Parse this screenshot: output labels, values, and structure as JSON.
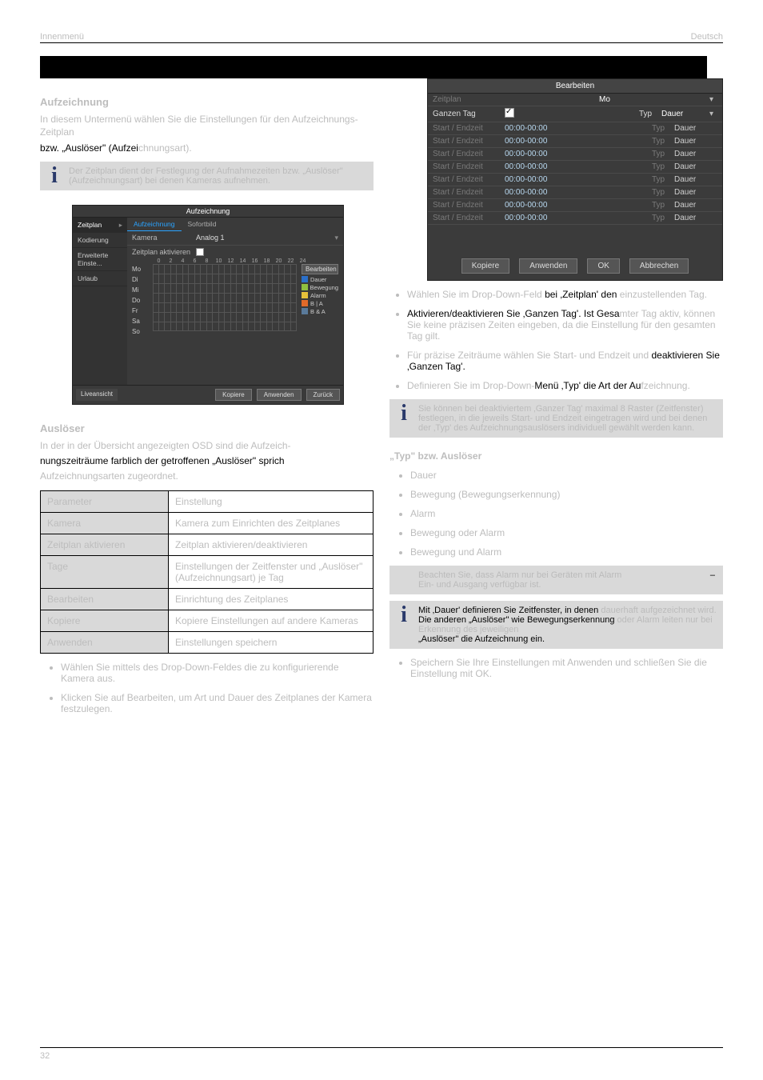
{
  "header": {
    "left": "Innenmenü",
    "right": "Deutsch"
  },
  "leftcol": {
    "h_aufzeichnung": "Aufzeichnung",
    "p_intro_faint": "In diesem Untermenü wählen Sie die Einstellungen für den Aufzeichnungs-Zeitplan",
    "p_trigger_before": "bzw. „Auslöser\" (Aufzei",
    "p_trigger_after": "chnungsart).",
    "info1": "Der Zeitplan dient der Festlegung der Aufnahmezeiten bzw. „Auslöser\" (Aufzeichnungsart) bei denen Kameras aufnehmen.",
    "h_ausloser": "Auslöser",
    "p_belowchart": "In der in der Übersicht angezeigten OSD sind die Aufzeich-",
    "p_color_line": "nungszeiträume farblich der getroffenen „Auslöser\" sprich",
    "p_color_after": "Aufzeichnungsarten zugeordnet.",
    "table": {
      "rows": [
        {
          "k": "Parameter",
          "v": "Einstellung"
        },
        {
          "k": "Kamera",
          "v": "Kamera zum Einrichten des Zeitplanes"
        },
        {
          "k": "Zeitplan aktivieren",
          "v": "Zeitplan aktivieren/deaktivieren"
        },
        {
          "k": "Tage",
          "v": "Einstellungen der Zeitfenster und „Auslöser\" (Aufzeichnungsart) je Tag"
        },
        {
          "k": "Bearbeiten",
          "v": "Einrichtung des Zeitplanes"
        },
        {
          "k": "Kopiere",
          "v": "Kopiere Einstellungen auf andere Kameras"
        },
        {
          "k": "Anwenden",
          "v": "Einstellungen speichern"
        }
      ]
    },
    "bullets_bottom": [
      "Wählen Sie mittels des Drop-Down-Feldes die zu konfigurierende Kamera aus.",
      "Klicken Sie auf Bearbeiten, um Art und Dauer des Zeitplanes der Kamera festzulegen."
    ],
    "aufz_panel": {
      "title": "Aufzeichnung",
      "sidebar": [
        "Zeitplan",
        "Kodierung",
        "Erweiterte Einste...",
        "Urlaub"
      ],
      "tabs": [
        "Aufzeichnung",
        "Sofortbild"
      ],
      "row_kamera": "Kamera",
      "row_kamera_v": "Analog 1",
      "row_activate": "Zeitplan aktivieren",
      "days": [
        "Mo",
        "Di",
        "Mi",
        "Do",
        "Fr",
        "Sa",
        "So"
      ],
      "hours": [
        "0",
        "2",
        "4",
        "6",
        "8",
        "10",
        "12",
        "14",
        "16",
        "18",
        "20",
        "22",
        "24"
      ],
      "legend": {
        "edit": "Bearbeiten",
        "dauer": "Dauer",
        "bewegung": "Bewegung",
        "alarm": "Alarm",
        "ba": "B | A",
        "bunda": "B & A"
      },
      "footer_live": "Liveansicht",
      "footer_kopiere": "Kopiere",
      "footer_anwenden": "Anwenden",
      "footer_zuruck": "Zurück"
    }
  },
  "rightcol": {
    "bearbeiten": {
      "title": "Bearbeiten",
      "zeitplan": "Zeitplan",
      "weekday": "Mo",
      "ganzen_tag_lbl": "Ganzen Tag",
      "typ": "Typ",
      "dauer": "Dauer",
      "startend": "Start / Endzeit",
      "time": "00:00-00:00",
      "btn_kopiere": "Kopiere",
      "btn_anwenden": "Anwenden",
      "btn_ok": "OK",
      "btn_abbrechen": "Abbrechen"
    },
    "p_bei": "bei ‚Zeitplan' den",
    "p_bei_pre": "Wählen Sie im Drop-Down-Feld",
    "p_bei_after": "einzustellenden Tag.",
    "p_aktiv_before": "Aktivieren/deaktivieren Sie ‚Ganzen Tag'. Ist Gesa",
    "p_aktiv_after": "mter Tag aktiv, können Sie keine präzisen Zeiten eingeben, da die Einstellung für den gesamten Tag gilt.",
    "p_prazise": "Für präzise Zeiträume wählen Sie Start- und Endzeit und",
    "p_deaktiv": "deaktivieren Sie ‚Ganzen Tag'.",
    "p_typmenu_before": "Definieren Sie im Drop-Down-",
    "p_typmenu": "Menü ‚Typ' die Art der Au",
    "p_typmenu_after": "fzeichnung.",
    "info2": "Sie können bei deaktiviertem ‚Ganzer Tag' maximal 8 Raster (Zeitfenster) festlegen, in die jeweils Start- und Endzeit eingetragen wird und bei denen der ‚Typ' des Aufzeichnungsauslösers individuell gewählt werden kann.",
    "h_typ": "„Typ\" bzw. Auslöser",
    "typ_items": [
      "Dauer",
      "Bewegung (Bewegungserkennung)",
      "Alarm",
      "Bewegung oder Alarm",
      "Bewegung und Alarm"
    ],
    "info3_pre": "Beachten Sie, dass Alarm nur bei Geräten mit Alarm",
    "info3_dash": "–",
    "info3_post": "Ein- und Ausgang verfügbar ist.",
    "info4_l1": "Mit ‚Dauer' definieren Sie Zeitfenster, in denen",
    "info4_l1b": "dauerhaft aufgezeichnet wird.",
    "info4_l2": "Die anderen „Auslöser\" wie Bewegungserkennung",
    "info4_l2b": "oder Alarm leiten nur bei Erkennung des jeweiligen",
    "info4_l3": "„Auslöser\" die Aufzeichnung ein.",
    "bullet_last": "Speichern Sie Ihre Einstellungen mit Anwenden und schließen Sie die Einstellung mit OK."
  },
  "footer": {
    "page": "32"
  },
  "colors": {
    "dauer": "#2b6fc8",
    "bewegung": "#8fbf3f",
    "alarm": "#e6c13a",
    "ba": "#e06a2a",
    "bunda": "#5a7a9a"
  }
}
